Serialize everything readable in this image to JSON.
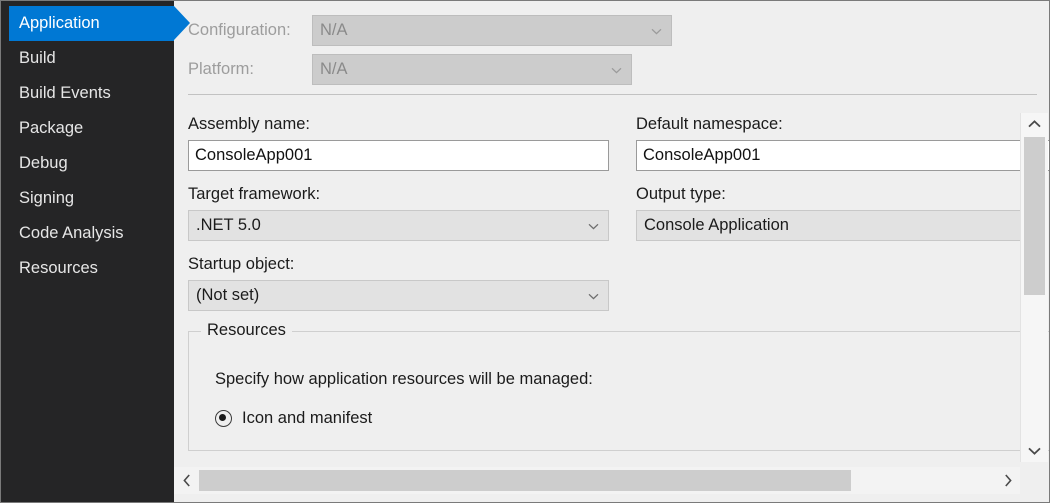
{
  "sidebar": {
    "items": [
      {
        "label": "Application",
        "selected": true
      },
      {
        "label": "Build",
        "selected": false
      },
      {
        "label": "Build Events",
        "selected": false
      },
      {
        "label": "Package",
        "selected": false
      },
      {
        "label": "Debug",
        "selected": false
      },
      {
        "label": "Signing",
        "selected": false
      },
      {
        "label": "Code Analysis",
        "selected": false
      },
      {
        "label": "Resources",
        "selected": false
      }
    ],
    "background_color": "#252526",
    "selected_color": "#0078d4"
  },
  "top": {
    "configuration_label": "Configuration:",
    "configuration_value": "N/A",
    "platform_label": "Platform:",
    "platform_value": "N/A"
  },
  "fields": {
    "assembly_name_label": "Assembly name:",
    "assembly_name_value": "ConsoleApp001",
    "default_namespace_label": "Default namespace:",
    "default_namespace_value": "ConsoleApp001",
    "target_framework_label": "Target framework:",
    "target_framework_value": ".NET 5.0",
    "output_type_label": "Output type:",
    "output_type_value": "Console Application",
    "startup_object_label": "Startup object:",
    "startup_object_value": "(Not set)"
  },
  "resources": {
    "legend": "Resources",
    "description": "Specify how application resources will be managed:",
    "option_icon_manifest": "Icon and manifest"
  },
  "scrollbars": {
    "up_arrow": "chevron-up",
    "down_arrow": "chevron-down",
    "left_arrow": "chevron-left",
    "right_arrow": "chevron-right"
  }
}
